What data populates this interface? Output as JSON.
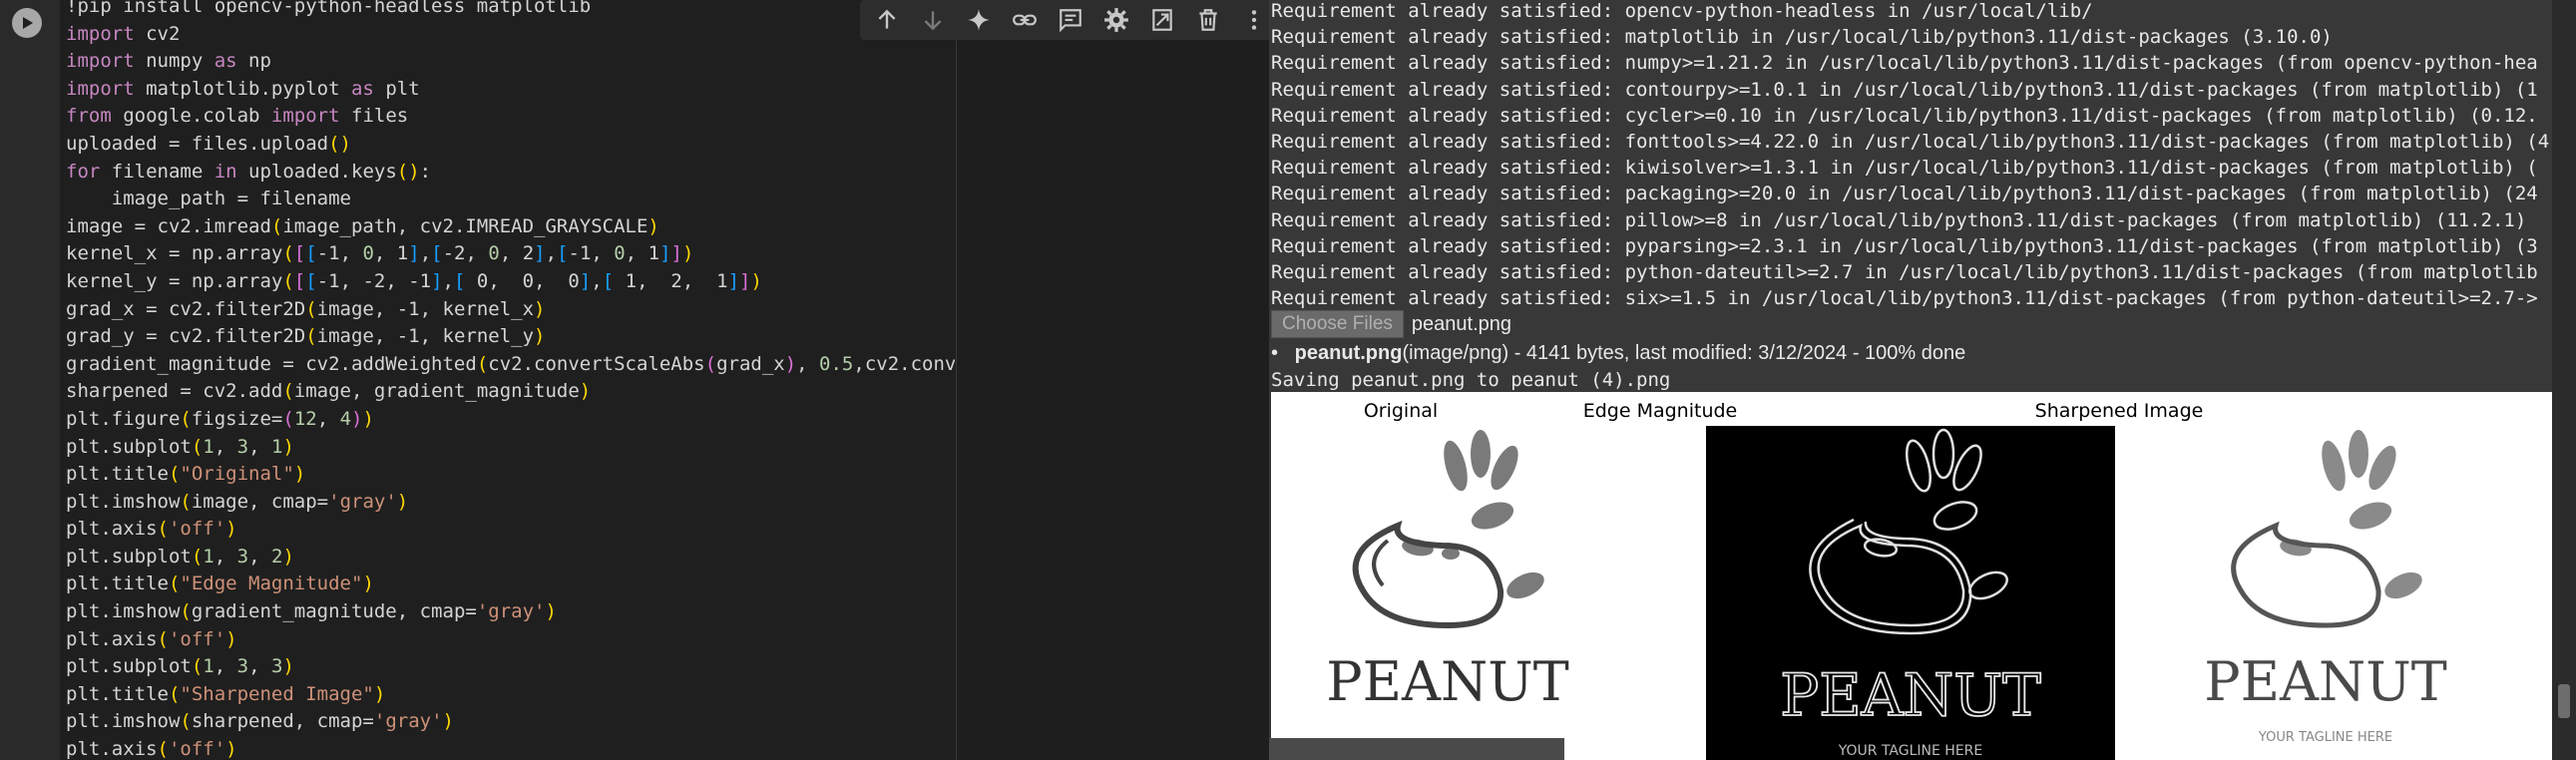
{
  "code": {
    "lines": [
      [
        {
          "t": "!pip install opencv-python-headless matplotlib",
          "c": ""
        }
      ],
      [
        {
          "t": "import",
          "c": "kw"
        },
        {
          "t": " cv2",
          "c": ""
        }
      ],
      [
        {
          "t": "import",
          "c": "kw"
        },
        {
          "t": " numpy ",
          "c": ""
        },
        {
          "t": "as",
          "c": "kw"
        },
        {
          "t": " np",
          "c": ""
        }
      ],
      [
        {
          "t": "import",
          "c": "kw"
        },
        {
          "t": " matplotlib.pyplot ",
          "c": ""
        },
        {
          "t": "as",
          "c": "kw"
        },
        {
          "t": " plt",
          "c": ""
        }
      ],
      [
        {
          "t": "from",
          "c": "kw"
        },
        {
          "t": " google.colab ",
          "c": ""
        },
        {
          "t": "import",
          "c": "kw"
        },
        {
          "t": " files",
          "c": ""
        }
      ],
      [
        {
          "t": "uploaded = files.upload",
          "c": ""
        },
        {
          "t": "()",
          "c": "br1"
        }
      ],
      [
        {
          "t": "for",
          "c": "kw"
        },
        {
          "t": " filename ",
          "c": ""
        },
        {
          "t": "in",
          "c": "kw"
        },
        {
          "t": " uploaded.keys",
          "c": ""
        },
        {
          "t": "()",
          "c": "br1"
        },
        {
          "t": ":",
          "c": ""
        }
      ],
      [
        {
          "t": "    image_path = filename",
          "c": ""
        }
      ],
      [
        {
          "t": "image = cv2.imread",
          "c": ""
        },
        {
          "t": "(",
          "c": "br1"
        },
        {
          "t": "image_path, cv2.IMREAD_GRAYSCALE",
          "c": ""
        },
        {
          "t": ")",
          "c": "br1"
        }
      ],
      [
        {
          "t": "kernel_x = np.array",
          "c": ""
        },
        {
          "t": "(",
          "c": "br1"
        },
        {
          "t": "[",
          "c": "br2"
        },
        {
          "t": "[",
          "c": "br3"
        },
        {
          "t": "-1, ",
          "c": ""
        },
        {
          "t": "0",
          "c": "num"
        },
        {
          "t": ", 1",
          "c": ""
        },
        {
          "t": "]",
          "c": "br3"
        },
        {
          "t": ",",
          "c": ""
        },
        {
          "t": "[",
          "c": "br3"
        },
        {
          "t": "-2, ",
          "c": ""
        },
        {
          "t": "0",
          "c": "num"
        },
        {
          "t": ", 2",
          "c": ""
        },
        {
          "t": "]",
          "c": "br3"
        },
        {
          "t": ",",
          "c": ""
        },
        {
          "t": "[",
          "c": "br3"
        },
        {
          "t": "-1, ",
          "c": ""
        },
        {
          "t": "0",
          "c": "num"
        },
        {
          "t": ", 1",
          "c": ""
        },
        {
          "t": "]",
          "c": "br3"
        },
        {
          "t": "]",
          "c": "br2"
        },
        {
          "t": ")",
          "c": "br1"
        }
      ],
      [
        {
          "t": "kernel_y = np.array",
          "c": ""
        },
        {
          "t": "(",
          "c": "br1"
        },
        {
          "t": "[",
          "c": "br2"
        },
        {
          "t": "[",
          "c": "br3"
        },
        {
          "t": "-1, -2, -1",
          "c": ""
        },
        {
          "t": "]",
          "c": "br3"
        },
        {
          "t": ",",
          "c": ""
        },
        {
          "t": "[",
          "c": "br3"
        },
        {
          "t": " 0,  0,  0",
          "c": ""
        },
        {
          "t": "]",
          "c": "br3"
        },
        {
          "t": ",",
          "c": ""
        },
        {
          "t": "[",
          "c": "br3"
        },
        {
          "t": " 1,  2,  1",
          "c": ""
        },
        {
          "t": "]",
          "c": "br3"
        },
        {
          "t": "]",
          "c": "br2"
        },
        {
          "t": ")",
          "c": "br1"
        }
      ],
      [
        {
          "t": "grad_x = cv2.filter2D",
          "c": ""
        },
        {
          "t": "(",
          "c": "br1"
        },
        {
          "t": "image, -1, kernel_x",
          "c": ""
        },
        {
          "t": ")",
          "c": "br1"
        }
      ],
      [
        {
          "t": "grad_y = cv2.filter2D",
          "c": ""
        },
        {
          "t": "(",
          "c": "br1"
        },
        {
          "t": "image, -1, kernel_y",
          "c": ""
        },
        {
          "t": ")",
          "c": "br1"
        }
      ],
      [
        {
          "t": "gradient_magnitude = cv2.addWeighted",
          "c": ""
        },
        {
          "t": "(",
          "c": "br1"
        },
        {
          "t": "cv2.convertScaleAbs",
          "c": ""
        },
        {
          "t": "(",
          "c": "br2"
        },
        {
          "t": "grad_x",
          "c": ""
        },
        {
          "t": ")",
          "c": "br2"
        },
        {
          "t": ", ",
          "c": ""
        },
        {
          "t": "0.5",
          "c": "num"
        },
        {
          "t": ",cv2.convertScaleAbs",
          "c": ""
        },
        {
          "t": "(",
          "c": "br2"
        },
        {
          "t": "grad_y",
          "c": ""
        },
        {
          "t": ")",
          "c": "br2"
        },
        {
          "t": ", ",
          "c": ""
        },
        {
          "t": "0.5",
          "c": "num"
        },
        {
          "t": ", ",
          "c": ""
        },
        {
          "t": "0",
          "c": "num"
        },
        {
          "t": ")",
          "c": "br1"
        }
      ],
      [
        {
          "t": "sharpened = cv2.add",
          "c": ""
        },
        {
          "t": "(",
          "c": "br1"
        },
        {
          "t": "image, gradient_magnitude",
          "c": ""
        },
        {
          "t": ")",
          "c": "br1"
        }
      ],
      [
        {
          "t": "plt.figure",
          "c": ""
        },
        {
          "t": "(",
          "c": "br1"
        },
        {
          "t": "figsize=",
          "c": ""
        },
        {
          "t": "(",
          "c": "br2"
        },
        {
          "t": "12",
          "c": "num"
        },
        {
          "t": ", ",
          "c": ""
        },
        {
          "t": "4",
          "c": "num"
        },
        {
          "t": ")",
          "c": "br2"
        },
        {
          "t": ")",
          "c": "br1"
        }
      ],
      [
        {
          "t": "plt.subplot",
          "c": ""
        },
        {
          "t": "(",
          "c": "br1"
        },
        {
          "t": "1",
          "c": "num"
        },
        {
          "t": ", ",
          "c": ""
        },
        {
          "t": "3",
          "c": "num"
        },
        {
          "t": ", ",
          "c": ""
        },
        {
          "t": "1",
          "c": "num"
        },
        {
          "t": ")",
          "c": "br1"
        }
      ],
      [
        {
          "t": "plt.title",
          "c": ""
        },
        {
          "t": "(",
          "c": "br1"
        },
        {
          "t": "\"Original\"",
          "c": "str"
        },
        {
          "t": ")",
          "c": "br1"
        }
      ],
      [
        {
          "t": "plt.imshow",
          "c": ""
        },
        {
          "t": "(",
          "c": "br1"
        },
        {
          "t": "image, cmap=",
          "c": ""
        },
        {
          "t": "'gray'",
          "c": "str"
        },
        {
          "t": ")",
          "c": "br1"
        }
      ],
      [
        {
          "t": "plt.axis",
          "c": ""
        },
        {
          "t": "(",
          "c": "br1"
        },
        {
          "t": "'off'",
          "c": "str"
        },
        {
          "t": ")",
          "c": "br1"
        }
      ],
      [
        {
          "t": "plt.subplot",
          "c": ""
        },
        {
          "t": "(",
          "c": "br1"
        },
        {
          "t": "1",
          "c": "num"
        },
        {
          "t": ", ",
          "c": ""
        },
        {
          "t": "3",
          "c": "num"
        },
        {
          "t": ", ",
          "c": ""
        },
        {
          "t": "2",
          "c": "num"
        },
        {
          "t": ")",
          "c": "br1"
        }
      ],
      [
        {
          "t": "plt.title",
          "c": ""
        },
        {
          "t": "(",
          "c": "br1"
        },
        {
          "t": "\"Edge Magnitude\"",
          "c": "str"
        },
        {
          "t": ")",
          "c": "br1"
        }
      ],
      [
        {
          "t": "plt.imshow",
          "c": ""
        },
        {
          "t": "(",
          "c": "br1"
        },
        {
          "t": "gradient_magnitude, cmap=",
          "c": ""
        },
        {
          "t": "'gray'",
          "c": "str"
        },
        {
          "t": ")",
          "c": "br1"
        }
      ],
      [
        {
          "t": "plt.axis",
          "c": ""
        },
        {
          "t": "(",
          "c": "br1"
        },
        {
          "t": "'off'",
          "c": "str"
        },
        {
          "t": ")",
          "c": "br1"
        }
      ],
      [
        {
          "t": "plt.subplot",
          "c": ""
        },
        {
          "t": "(",
          "c": "br1"
        },
        {
          "t": "1",
          "c": "num"
        },
        {
          "t": ", ",
          "c": ""
        },
        {
          "t": "3",
          "c": "num"
        },
        {
          "t": ", ",
          "c": ""
        },
        {
          "t": "3",
          "c": "num"
        },
        {
          "t": ")",
          "c": "br1"
        }
      ],
      [
        {
          "t": "plt.title",
          "c": ""
        },
        {
          "t": "(",
          "c": "br1"
        },
        {
          "t": "\"Sharpened Image\"",
          "c": "str"
        },
        {
          "t": ")",
          "c": "br1"
        }
      ],
      [
        {
          "t": "plt.imshow",
          "c": ""
        },
        {
          "t": "(",
          "c": "br1"
        },
        {
          "t": "sharpened, cmap=",
          "c": ""
        },
        {
          "t": "'gray'",
          "c": "str"
        },
        {
          "t": ")",
          "c": "br1"
        }
      ],
      [
        {
          "t": "plt.axis",
          "c": ""
        },
        {
          "t": "(",
          "c": "br1"
        },
        {
          "t": "'off'",
          "c": "str"
        },
        {
          "t": ")",
          "c": "br1"
        }
      ]
    ]
  },
  "toolbar_icons": [
    "arrow-up-icon",
    "arrow-down-icon",
    "sparkle-icon",
    "link-icon",
    "comment-icon",
    "gear-icon",
    "mirror-cell-icon",
    "delete-icon",
    "more-vert-icon"
  ],
  "output": {
    "pip_lines": [
      "Requirement already satisfied: opencv-python-headless in /usr/local/lib/",
      "Requirement already satisfied: matplotlib in /usr/local/lib/python3.11/dist-packages (3.10.0)",
      "Requirement already satisfied: numpy>=1.21.2 in /usr/local/lib/python3.11/dist-packages (from opencv-python-hea",
      "Requirement already satisfied: contourpy>=1.0.1 in /usr/local/lib/python3.11/dist-packages (from matplotlib) (1",
      "Requirement already satisfied: cycler>=0.10 in /usr/local/lib/python3.11/dist-packages (from matplotlib) (0.12.",
      "Requirement already satisfied: fonttools>=4.22.0 in /usr/local/lib/python3.11/dist-packages (from matplotlib) (4",
      "Requirement already satisfied: kiwisolver>=1.3.1 in /usr/local/lib/python3.11/dist-packages (from matplotlib) (",
      "Requirement already satisfied: packaging>=20.0 in /usr/local/lib/python3.11/dist-packages (from matplotlib) (24",
      "Requirement already satisfied: pillow>=8 in /usr/local/lib/python3.11/dist-packages (from matplotlib) (11.2.1)",
      "Requirement already satisfied: pyparsing>=2.3.1 in /usr/local/lib/python3.11/dist-packages (from matplotlib) (3",
      "Requirement already satisfied: python-dateutil>=2.7 in /usr/local/lib/python3.11/dist-packages (from matplotlib",
      "Requirement already satisfied: six>=1.5 in /usr/local/lib/python3.11/dist-packages (from python-dateutil>=2.7->"
    ],
    "choose_files_label": "Choose Files",
    "chosen_file": "peanut.png",
    "file_name": "peanut.png",
    "file_meta": "(image/png) - 4141 bytes, last modified: 3/12/2024 - 100% done",
    "saving_line": "Saving peanut.png to peanut (4).png",
    "figure_titles": [
      "Original",
      "Edge Magnitude",
      "Sharpened Image"
    ],
    "logo_text": "PEANUT",
    "logo_tagline": "YOUR TAGLINE HERE"
  },
  "colors": {
    "editor_bg": "#1f1f1f",
    "output_bg": "#383838",
    "keyword": "#c586c0",
    "string": "#ce9178",
    "number": "#b5cea8"
  }
}
